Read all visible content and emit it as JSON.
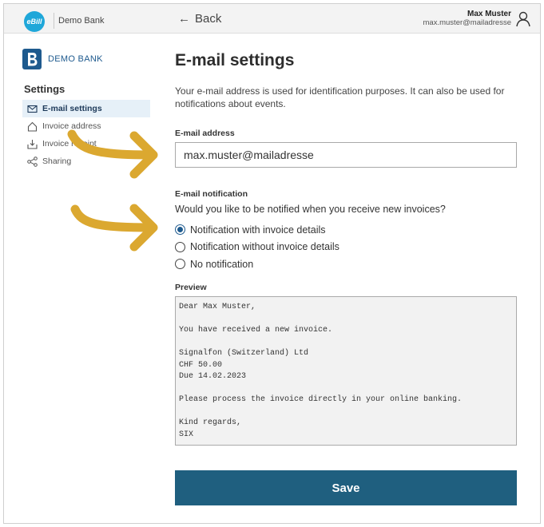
{
  "topbar": {
    "ebill_logo": "eBill",
    "brand": "Demo Bank",
    "back_label": "Back",
    "user_name": "Max Muster",
    "user_email": "max.muster@mailadresse"
  },
  "sidebar": {
    "bank_name": "DEMO BANK",
    "title": "Settings",
    "items": [
      {
        "label": "E-mail settings",
        "icon": "envelope-icon",
        "active": true
      },
      {
        "label": "Invoice address",
        "icon": "home-icon",
        "active": false
      },
      {
        "label": "Invoice receipt",
        "icon": "inbox-icon",
        "active": false
      },
      {
        "label": "Sharing",
        "icon": "share-icon",
        "active": false
      }
    ]
  },
  "main": {
    "title": "E-mail settings",
    "intro": "Your e-mail address is used for identification purposes. It can also be used for notifications about events.",
    "email_label": "E-mail address",
    "email_value": "max.muster@mailadresse",
    "notification_label": "E-mail notification",
    "notification_question": "Would you like to be notified when you receive new invoices?",
    "options": [
      {
        "label": "Notification with invoice details",
        "selected": true
      },
      {
        "label": "Notification without invoice details",
        "selected": false
      },
      {
        "label": "No notification",
        "selected": false
      }
    ],
    "preview_label": "Preview",
    "preview_text": "Dear Max Muster,\n\nYou have received a new invoice.\n\nSignalfon (Switzerland) Ltd\nCHF 50.00\nDue 14.02.2023\n\nPlease process the invoice directly in your online banking.\n\nKind regards,\nSIX",
    "save_label": "Save"
  },
  "colors": {
    "accent": "#1f5f7f",
    "ebill_blue": "#1fa7d9",
    "annotation_arrow": "#dba830"
  }
}
